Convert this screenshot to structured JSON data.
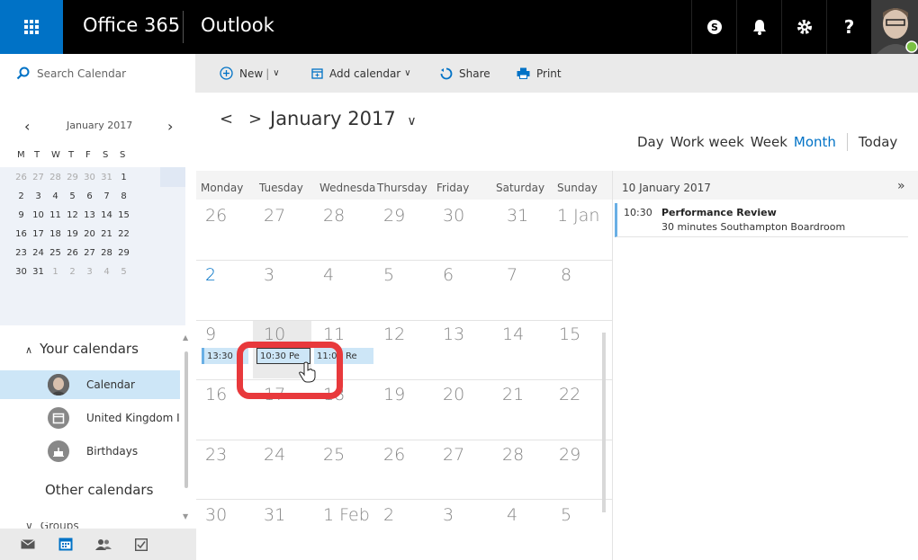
{
  "topbar": {
    "suite": "Office 365",
    "app": "Outlook",
    "icons": [
      "skype-icon",
      "bell-icon",
      "gear-icon",
      "help-icon"
    ],
    "help_glyph": "?"
  },
  "commands": {
    "search_placeholder": "Search Calendar",
    "new_label": "New",
    "new_sep": "|",
    "add_calendar_label": "Add calendar",
    "share_label": "Share",
    "print_label": "Print"
  },
  "minical": {
    "title": "January 2017",
    "prev": "‹",
    "next": "›",
    "weekdays": [
      "M",
      "T",
      "W",
      "T",
      "F",
      "S",
      "S"
    ],
    "weeks": [
      [
        "26",
        "27",
        "28",
        "29",
        "30",
        "31",
        "1"
      ],
      [
        "2",
        "3",
        "4",
        "5",
        "6",
        "7",
        "8"
      ],
      [
        "9",
        "10",
        "11",
        "12",
        "13",
        "14",
        "15"
      ],
      [
        "16",
        "17",
        "18",
        "19",
        "20",
        "21",
        "22"
      ],
      [
        "23",
        "24",
        "25",
        "26",
        "27",
        "28",
        "29"
      ],
      [
        "30",
        "31",
        "1",
        "2",
        "3",
        "4",
        "5"
      ]
    ]
  },
  "left": {
    "your_calendars": "Your calendars",
    "calendars": [
      {
        "label": "Calendar",
        "selected": true
      },
      {
        "label": "United Kingdom I"
      },
      {
        "label": "Birthdays"
      }
    ],
    "other_calendars": "Other calendars",
    "groups_partial": "Groups"
  },
  "calendar": {
    "title": "January 2017",
    "prev": "<",
    "next": ">",
    "views": [
      "Day",
      "Work week",
      "Week",
      "Month",
      "Today"
    ],
    "active_view": "Month",
    "accent": "#0072c6",
    "day_headers": [
      "Monday",
      "Tuesday",
      "Wednesda",
      "Thursday",
      "Friday",
      "Saturday",
      "Sunday"
    ],
    "weeks": [
      [
        "26",
        "27",
        "28",
        "29",
        "30",
        "31",
        "1 Jan"
      ],
      [
        "2",
        "3",
        "4",
        "5",
        "6",
        "7",
        "8"
      ],
      [
        "9",
        "10",
        "11",
        "12",
        "13",
        "14",
        "15"
      ],
      [
        "16",
        "17",
        "18",
        "19",
        "20",
        "21",
        "22"
      ],
      [
        "23",
        "24",
        "25",
        "26",
        "27",
        "28",
        "29"
      ],
      [
        "30",
        "31",
        "1 Feb",
        "2",
        "3",
        "4",
        "5"
      ]
    ],
    "events": [
      {
        "label": "13:30",
        "day": "Monday 9"
      },
      {
        "label": "10:30 Pe",
        "day": "Tuesday 10",
        "selected": true
      },
      {
        "label": "11:00 Re",
        "day": "Wednesday 11"
      }
    ],
    "highlight_color": "#e8393c"
  },
  "agenda": {
    "date": "10 January 2017",
    "expand": "»",
    "item": {
      "time": "10:30",
      "title": "Performance Review",
      "detail": "30 minutes  Southampton Boardroom"
    }
  }
}
